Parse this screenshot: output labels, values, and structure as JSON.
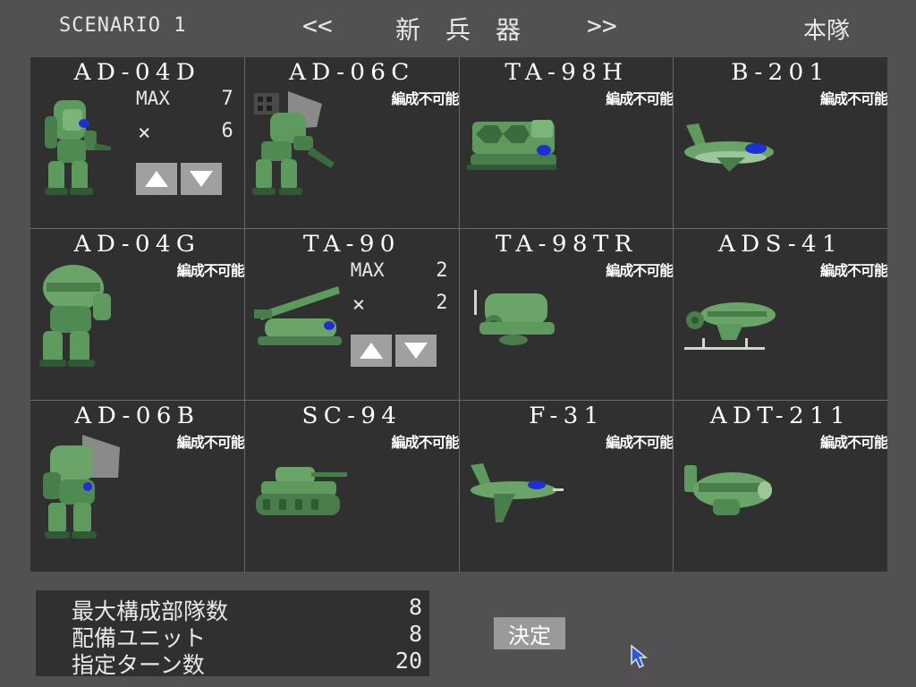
{
  "header": {
    "scenario": "SCENARIO 1",
    "prev": "<<",
    "title_chars": [
      "新",
      "兵",
      "器"
    ],
    "next": ">>",
    "team": "本隊"
  },
  "units": [
    {
      "name": "AD-04D",
      "status": "",
      "max_label": "MAX",
      "max": "7",
      "count_label": "×",
      "count": "6",
      "adjustable": true,
      "sprite": "mech"
    },
    {
      "name": "AD-06C",
      "status": "編成不可能",
      "sprite": "mech-missile"
    },
    {
      "name": "TA-98H",
      "status": "編成不可能",
      "sprite": "launcher"
    },
    {
      "name": "B-201",
      "status": "編成不可能",
      "sprite": "jet"
    },
    {
      "name": "AD-04G",
      "status": "編成不可能",
      "sprite": "mech-heavy"
    },
    {
      "name": "TA-90",
      "status": "",
      "max_label": "MAX",
      "max": "2",
      "count_label": "×",
      "count": "2",
      "adjustable": true,
      "sprite": "artillery"
    },
    {
      "name": "TA-98TR",
      "status": "編成不可能",
      "sprite": "radar-vehicle"
    },
    {
      "name": "ADS-41",
      "status": "編成不可能",
      "sprite": "gunship"
    },
    {
      "name": "AD-06B",
      "status": "編成不可能",
      "sprite": "mech-shield"
    },
    {
      "name": "SC-94",
      "status": "編成不可能",
      "sprite": "tank"
    },
    {
      "name": "F-31",
      "status": "編成不可能",
      "sprite": "fighter"
    },
    {
      "name": "ADT-211",
      "status": "編成不可能",
      "sprite": "transport"
    }
  ],
  "info": [
    {
      "label": "最大構成部隊数",
      "value": "8"
    },
    {
      "label": "配備ユニット",
      "value": "8"
    },
    {
      "label": "指定ターン数",
      "value": "20"
    }
  ],
  "confirm_label": "決定",
  "colors": {
    "background": "#525052",
    "cell": "#313031",
    "unit_green": "#5e9a5e",
    "unit_dark": "#2f5a34",
    "canopy_blue": "#2030d0",
    "button": "#a0a0a0"
  }
}
